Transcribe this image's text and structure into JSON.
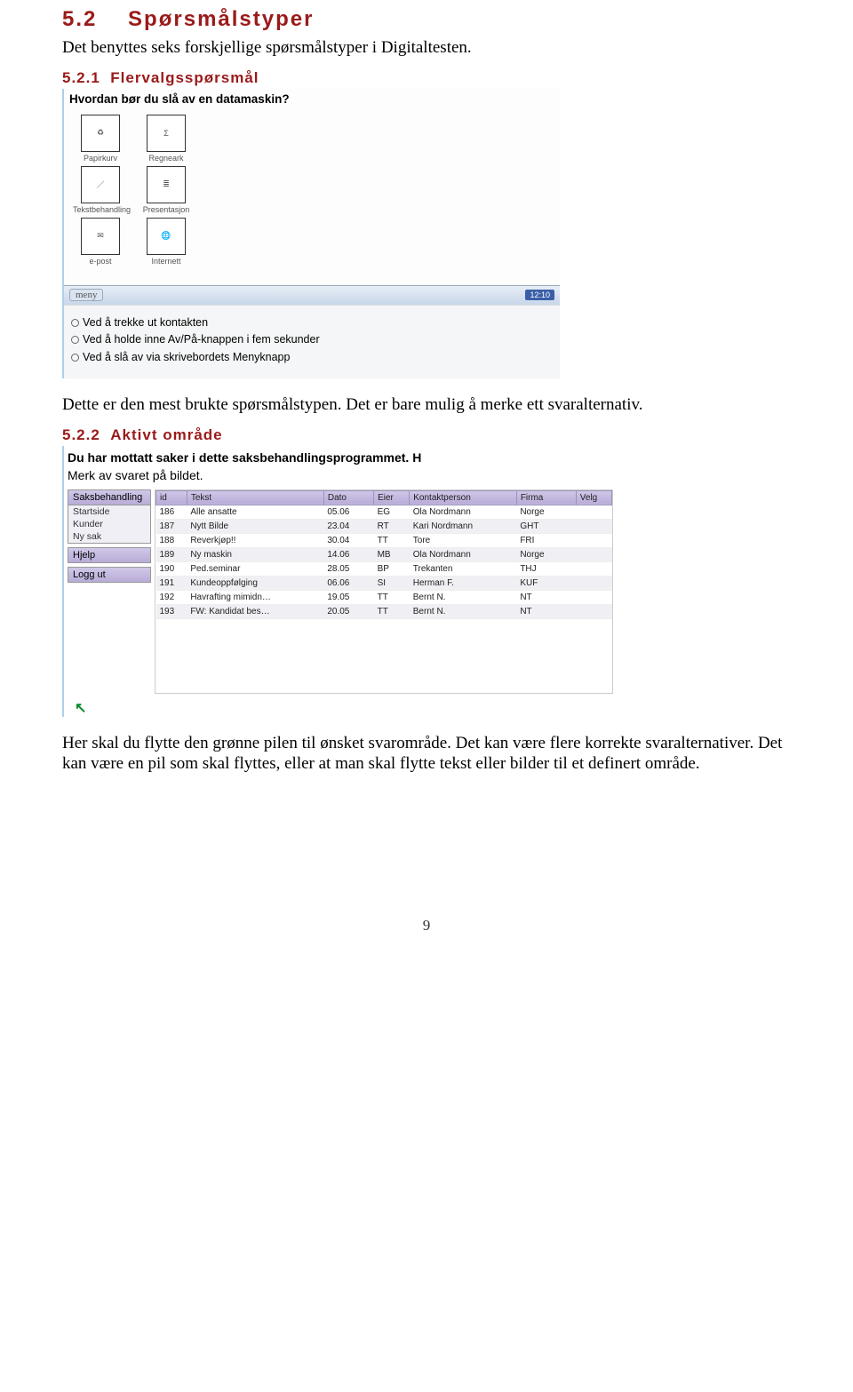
{
  "section": {
    "num": "5.2",
    "title": "Spørsmålstyper",
    "intro": "Det benyttes seks forskjellige spørsmålstyper i Digitaltesten."
  },
  "sub1": {
    "num": "5.2.1",
    "title": "Flervalgsspørsmål",
    "question": "Hvordan bør du slå av en datamaskin?",
    "icons": [
      {
        "label": "Papirkurv",
        "glyph": "♻"
      },
      {
        "label": "Regneark",
        "glyph": "Σ"
      },
      {
        "label": "Tekstbehandling",
        "glyph": "／"
      },
      {
        "label": "Presentasjon",
        "glyph": "≣"
      },
      {
        "label": "e-post",
        "glyph": "✉"
      },
      {
        "label": "Internett",
        "glyph": "🌐"
      }
    ],
    "taskbar": {
      "menu": "meny",
      "clock": "12:10"
    },
    "options": [
      "Ved å trekke ut kontakten",
      "Ved å holde inne Av/På-knappen i fem sekunder",
      "Ved å slå av via skrivebordets Menyknapp"
    ],
    "after": "Dette er den mest brukte spørsmålstypen. Det er bare mulig å merke ett svaralternativ."
  },
  "sub2": {
    "num": "5.2.2",
    "title": "Aktivt område",
    "instr1": "Du har mottatt saker i dette saksbehandlingsprogrammet. H",
    "instr2": "Merk av svaret på bildet.",
    "sidebar": {
      "block1_header": "Saksbehandling",
      "block1_items": [
        "Startside",
        "Kunder",
        "Ny sak"
      ],
      "block2": "Hjelp",
      "block3": "Logg ut"
    },
    "table": {
      "headers": [
        "id",
        "Tekst",
        "Dato",
        "Eier",
        "Kontaktperson",
        "Firma",
        "Velg"
      ],
      "rows": [
        [
          "186",
          "Alle ansatte",
          "05.06",
          "EG",
          "Ola Nordmann",
          "Norge",
          ""
        ],
        [
          "187",
          "Nytt Bilde",
          "23.04",
          "RT",
          "Kari Nordmann",
          "GHT",
          ""
        ],
        [
          "188",
          "Reverkjøp!!",
          "30.04",
          "TT",
          "Tore",
          "FRI",
          ""
        ],
        [
          "189",
          "Ny maskin",
          "14.06",
          "MB",
          "Ola Nordmann",
          "Norge",
          ""
        ],
        [
          "190",
          "Ped.seminar",
          "28.05",
          "BP",
          "Trekanten",
          "THJ",
          ""
        ],
        [
          "191",
          "Kundeoppfølging",
          "06.06",
          "SI",
          "Herman F.",
          "KUF",
          ""
        ],
        [
          "192",
          "Havrafting mimidn…",
          "19.05",
          "TT",
          "Bernt N.",
          "NT",
          ""
        ],
        [
          "193",
          "FW: Kandidat bes…",
          "20.05",
          "TT",
          "Bernt N.",
          "NT",
          ""
        ]
      ]
    },
    "cursor_glyph": "↖",
    "after": "Her skal du flytte den grønne pilen til ønsket svarområde. Det kan være flere korrekte svaralternativer. Det kan være en pil som skal flyttes, eller at man skal flytte tekst eller bilder til et definert område."
  },
  "page_number": "9"
}
